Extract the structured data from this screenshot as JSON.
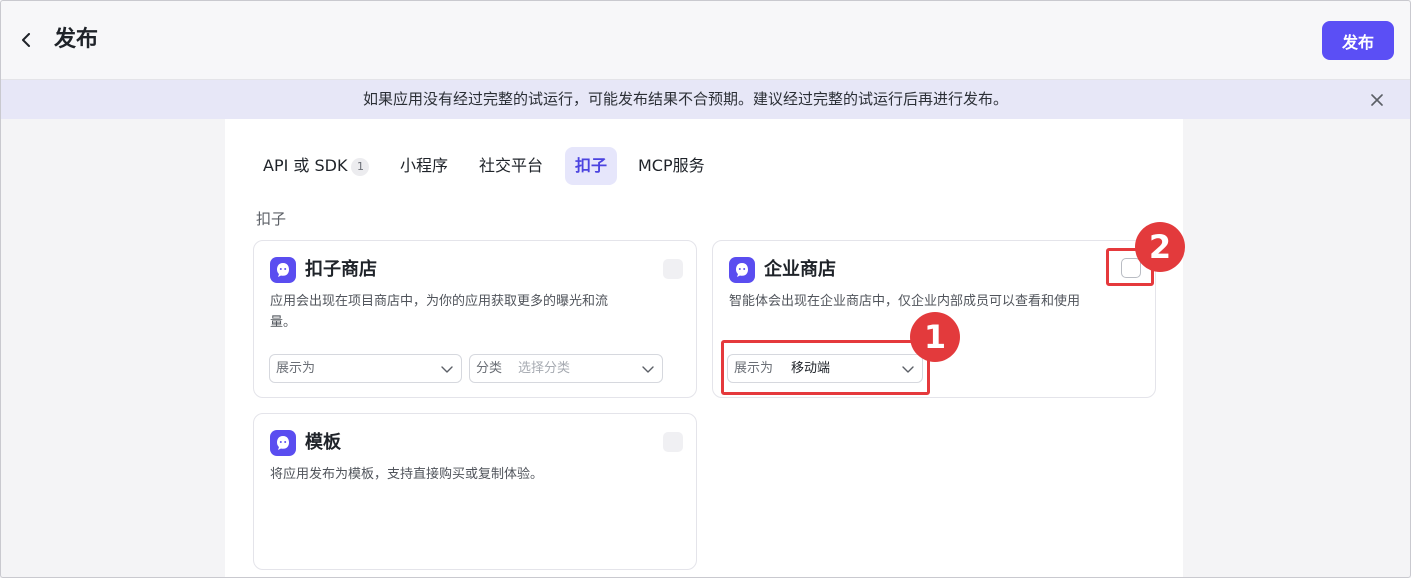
{
  "header": {
    "title": "发布",
    "publish_label": "发布"
  },
  "notice": {
    "text": "如果应用没有经过完整的试运行，可能发布结果不合预期。建议经过完整的试运行后再进行发布。"
  },
  "tabs": [
    {
      "label": "API 或 SDK",
      "badge": "1"
    },
    {
      "label": "小程序"
    },
    {
      "label": "社交平台"
    },
    {
      "label": "扣子",
      "active": true
    },
    {
      "label": "MCP服务"
    }
  ],
  "section": {
    "label": "扣子"
  },
  "cards": {
    "store": {
      "title": "扣子商店",
      "desc_line1": "应用会出现在项目商店中，为你的应用获取更多的曝光和流",
      "desc_line2": "量。",
      "display_label": "展示为",
      "category_label": "分类",
      "category_placeholder": "选择分类"
    },
    "enterprise": {
      "title": "企业商店",
      "desc": "智能体会出现在企业商店中，仅企业内部成员可以查看和使用",
      "display_label": "展示为",
      "display_value": "移动端"
    },
    "template": {
      "title": "模板",
      "desc": "将应用发布为模板，支持直接购买或复制体验。"
    }
  },
  "annotations": {
    "badge1": "1",
    "badge2": "2"
  },
  "colors": {
    "accent": "#5b4ff5",
    "notice_bg": "#e7e7f7",
    "highlight": "#e5393c"
  },
  "icons": {
    "back": "chevron-left-icon",
    "close": "close-icon",
    "app": "coze-mascot-icon",
    "dropdown": "chevron-down-icon"
  }
}
